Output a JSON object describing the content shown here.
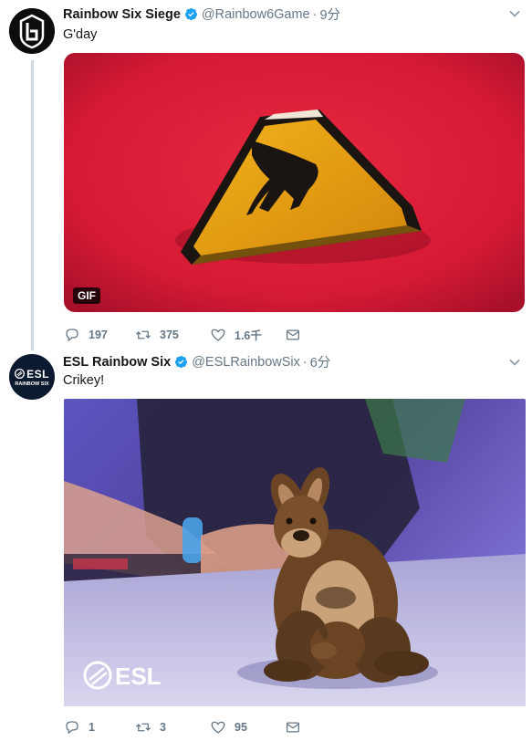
{
  "tweets": [
    {
      "display_name": "Rainbow Six Siege",
      "handle": "@Rainbow6Game",
      "time": "9分",
      "text": "G'day",
      "media_badge": "GIF",
      "actions": {
        "replies": "197",
        "retweets": "375",
        "likes": "1.6千"
      }
    },
    {
      "display_name": "ESL Rainbow Six",
      "handle": "@ESLRainbowSix",
      "time": "6分",
      "text": "Crikey!",
      "media_watermark": "ESL",
      "avatar_text": {
        "top": "ESL",
        "bottom": "RAINBOW SIX"
      },
      "actions": {
        "replies": "1",
        "retweets": "3",
        "likes": "95"
      }
    }
  ],
  "colors": {
    "verified_blue": "#1da1f2",
    "secondary_text": "#657786",
    "thread_line": "#cfd9de"
  }
}
